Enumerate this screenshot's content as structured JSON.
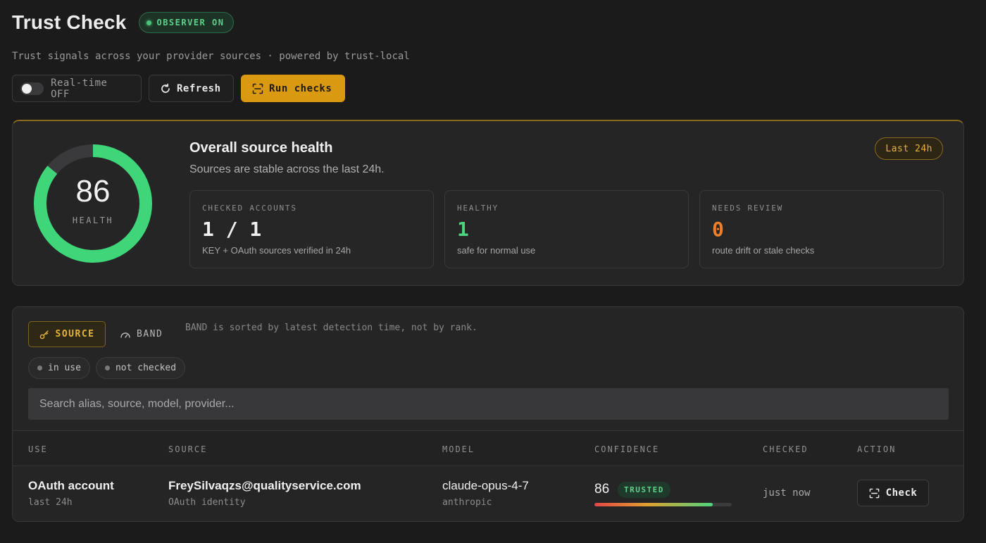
{
  "header": {
    "title": "Trust Check",
    "observer_badge": "OBSERVER ON",
    "subtitle": "Trust signals across your provider sources · powered by trust-local"
  },
  "toolbar": {
    "realtime_label": "Real-time OFF",
    "realtime_enabled": false,
    "refresh_label": "Refresh",
    "run_label": "Run checks"
  },
  "health": {
    "score": "86",
    "score_fraction": 0.86,
    "score_label": "HEALTH",
    "title": "Overall source health",
    "subtitle": "Sources are stable across the last 24h.",
    "range_badge": "Last 24h",
    "stats": [
      {
        "label": "CHECKED ACCOUNTS",
        "value": "1 / 1",
        "desc": "KEY + OAuth sources verified in 24h"
      },
      {
        "label": "HEALTHY",
        "value": "1",
        "desc": "safe for normal use"
      },
      {
        "label": "NEEDS REVIEW",
        "value": "0",
        "desc": "route drift or stale checks"
      }
    ]
  },
  "table": {
    "tabs": {
      "source": "SOURCE",
      "band": "BAND"
    },
    "note": "BAND is sorted by latest detection time, not by rank.",
    "chips": [
      "in use",
      "not checked"
    ],
    "search_placeholder": "Search alias, source, model, provider...",
    "columns": [
      "USE",
      "SOURCE",
      "MODEL",
      "CONFIDENCE",
      "CHECKED",
      "ACTION"
    ],
    "rows": [
      {
        "use": "OAuth account",
        "use_sub": "last 24h",
        "source": "FreySilvaqzs@qualityservice.com",
        "source_sub": "OAuth identity",
        "model": "claude-opus-4-7",
        "model_sub": "anthropic",
        "confidence": "86",
        "confidence_fraction": 0.86,
        "confidence_badge": "TRUSTED",
        "checked": "just now",
        "action": "Check"
      }
    ]
  },
  "colors": {
    "accent": "#d99a12",
    "healthy": "#4cd47e",
    "warning": "#ee7f2a",
    "background": "#1b1b1c"
  }
}
